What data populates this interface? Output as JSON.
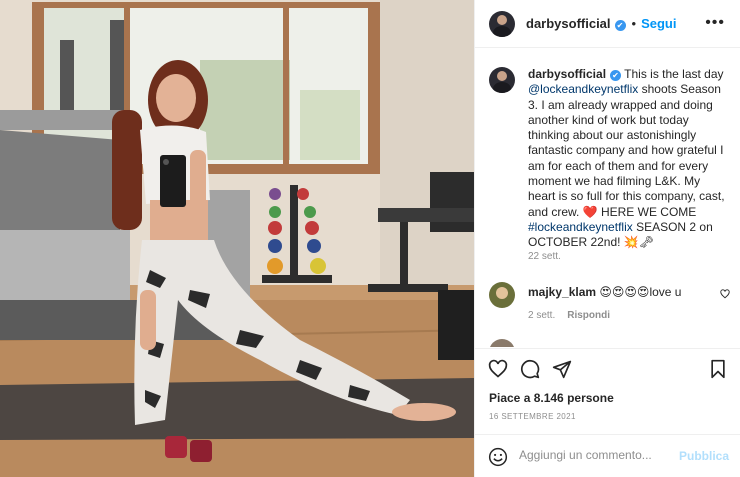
{
  "header": {
    "username": "darbysofficial",
    "verified_mark": "✔",
    "separator": "•",
    "follow_label": "Segui",
    "more_icon": "more-horizontal-icon"
  },
  "caption": {
    "username": "darbysofficial",
    "verified_mark": "✔",
    "text_1": "This is the last day",
    "mention": "@lockeandkeynetflix",
    "text_2": "shoots Season 3. I am already wrapped and doing another kind of work but today thinking about our astonishingly fantastic company and how grateful I am for each of them and for every moment we had filming L&K. My heart is so full for this company, cast, and crew. ❤️ HERE WE COME",
    "hashtag": "#lockeandkeynetflix",
    "text_3": "SEASON 2 on OCTOBER 22nd! 💥🗝",
    "timestamp": "22 sett."
  },
  "comments": [
    {
      "username": "majky_klam",
      "text": "😍😍😍😍love u",
      "timestamp": "2 sett.",
      "reply_label": "Rispondi"
    }
  ],
  "actions": {
    "like_icon": "heart-icon",
    "comment_icon": "comment-icon",
    "share_icon": "send-icon",
    "save_icon": "bookmark-icon"
  },
  "likes_text": "Piace a 8.146 persone",
  "date_text": "16 SETTEMBRE 2021",
  "add_comment": {
    "emoji_icon": "smiley-icon",
    "placeholder": "Aggiungi un commento...",
    "publish_label": "Pubblica"
  },
  "colors": {
    "accent": "#0095f6",
    "verified": "#3897f0",
    "publish_disabled": "#b2dffc",
    "muted": "#8e8e8e"
  }
}
